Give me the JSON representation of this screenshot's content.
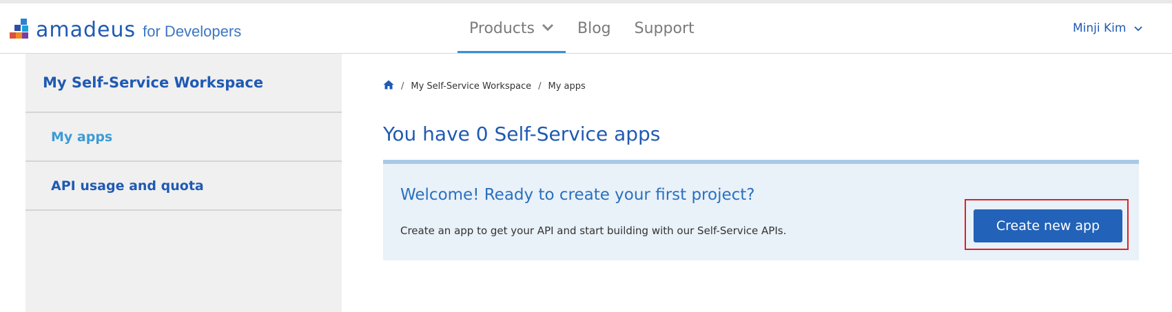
{
  "brand": {
    "name": "amadeus",
    "sub": "for Developers",
    "colors": {
      "primary": "#1f5ab3",
      "accent": "#3c8fd1",
      "highlight_outline": "#e02020"
    }
  },
  "nav": {
    "items": [
      {
        "label": "Products",
        "active": true,
        "icon": "chevron-down-icon"
      },
      {
        "label": "Blog",
        "active": false
      },
      {
        "label": "Support",
        "active": false
      }
    ]
  },
  "user": {
    "name": "Minji Kim",
    "icon": "chevron-down-icon"
  },
  "sidebar": {
    "title": "My Self-Service Workspace",
    "items": [
      {
        "label": "My apps",
        "current": true
      },
      {
        "label": "API usage and quota",
        "current": false
      }
    ]
  },
  "breadcrumb": {
    "home_icon": "home-icon",
    "items": [
      "My Self-Service Workspace",
      "My apps"
    ]
  },
  "main": {
    "heading": "You have 0 Self-Service apps",
    "panel": {
      "title": "Welcome! Ready to create your first project?",
      "text": "Create an app to get your API and start building with our Self-Service APIs.",
      "button_label": "Create new app"
    }
  }
}
